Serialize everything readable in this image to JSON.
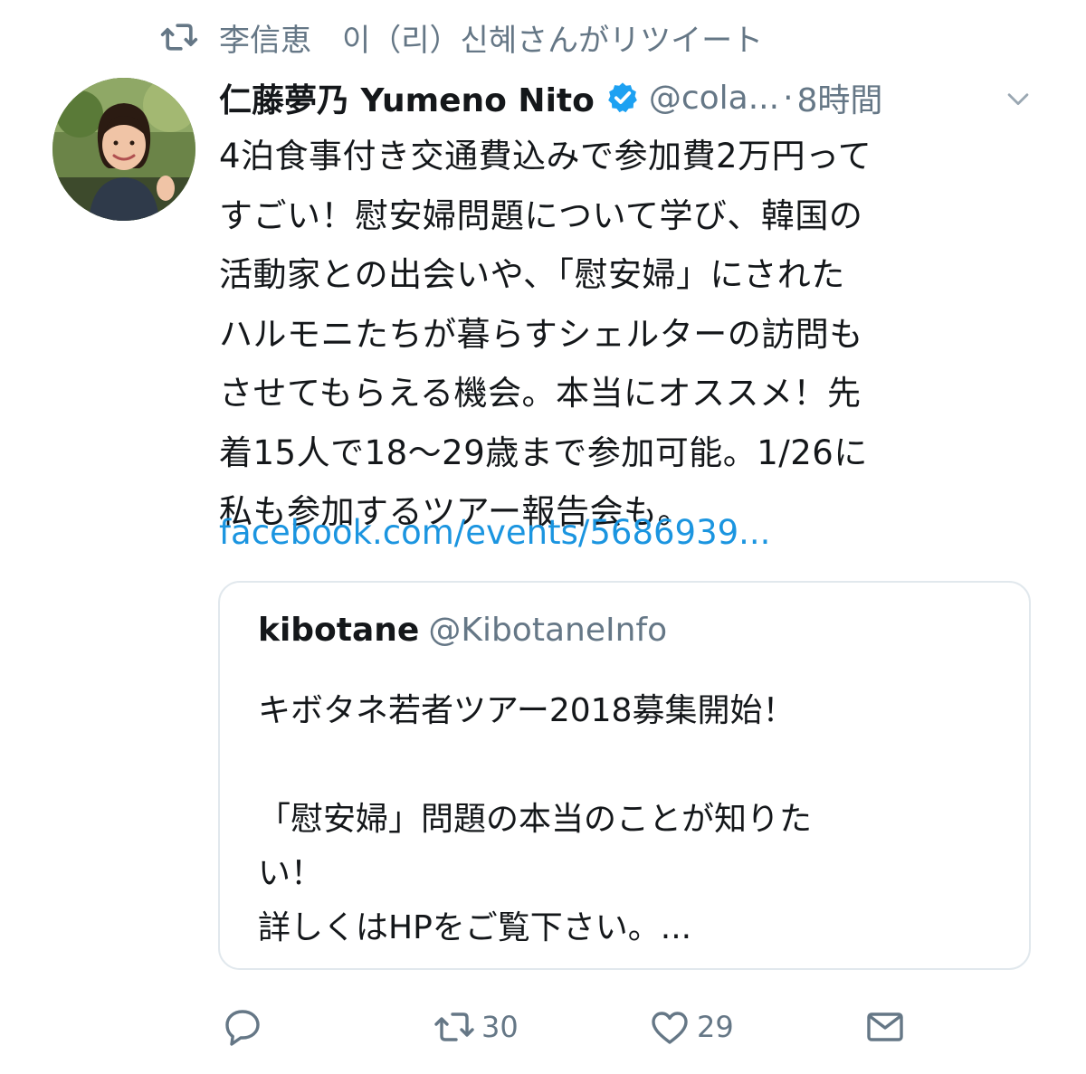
{
  "retweet_context": {
    "icon": "retweet-icon",
    "text": "李信恵　이（리）신혜さんがリツイート"
  },
  "tweet": {
    "author": {
      "name": "仁藤夢乃 Yumeno Nito",
      "handle": "@cola...",
      "verified": true
    },
    "separator": "·",
    "time": "8時間",
    "text_lines": [
      "4泊食事付き交通費込みで参加費2万円って",
      "すごい！慰安婦問題について学び、韓国の",
      "活動家との出会いや、「慰安婦」にされた",
      "ハルモニたちが暮らすシェルターの訪問も",
      "させてもらえる機会。本当にオススメ！先",
      "着15人で18〜29歳まで参加可能。1/26に",
      "私も参加するツアー報告会も。"
    ],
    "link": "facebook.com/events/5686939..."
  },
  "quoted_tweet": {
    "name": "kibotane",
    "handle": "@KibotaneInfo",
    "text_lines": [
      "キボタネ若者ツアー2018募集開始！",
      "",
      "「慰安婦」問題の本当のことが知りた",
      "い！",
      "詳しくはHPをご覧下さい。..."
    ]
  },
  "actions": {
    "reply": {
      "icon": "reply-icon"
    },
    "retweet": {
      "icon": "retweet-icon",
      "count": "30"
    },
    "like": {
      "icon": "heart-icon",
      "count": "29"
    },
    "dm": {
      "icon": "envelope-icon"
    }
  },
  "colors": {
    "text": "#14171a",
    "secondary": "#657786",
    "link": "#1b95e0",
    "verified": "#1da1f2",
    "border": "#e1e8ed"
  }
}
